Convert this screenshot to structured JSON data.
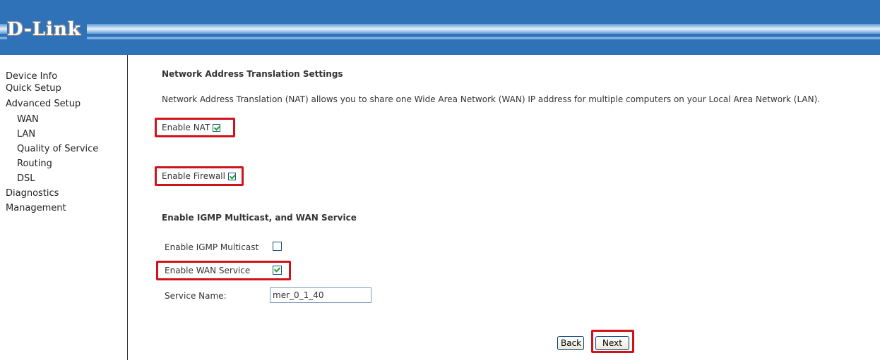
{
  "header": {
    "logo_text": "D-Link"
  },
  "sidebar": {
    "items": [
      {
        "label": "Device Info"
      },
      {
        "label": "Quick Setup"
      },
      {
        "label": "Advanced Setup"
      },
      {
        "label": "WAN"
      },
      {
        "label": "LAN"
      },
      {
        "label": "Quality of Service"
      },
      {
        "label": "Routing"
      },
      {
        "label": "DSL"
      },
      {
        "label": "Diagnostics"
      },
      {
        "label": "Management"
      }
    ]
  },
  "main": {
    "title": "Network Address Translation Settings",
    "description": "Network Address Translation (NAT) allows you to share one Wide Area Network (WAN) IP address for multiple computers on your Local Area Network (LAN).",
    "enable_nat": {
      "label": "Enable NAT",
      "checked": true
    },
    "enable_firewall": {
      "label": "Enable Firewall",
      "checked": true
    },
    "igmp_heading": "Enable IGMP Multicast, and WAN Service",
    "enable_igmp": {
      "label": "Enable IGMP Multicast",
      "checked": false
    },
    "enable_wan": {
      "label": "Enable WAN Service",
      "checked": true
    },
    "service_name": {
      "label": "Service Name:",
      "value": "mer_0_1_40"
    },
    "back_label": "Back",
    "next_label": "Next"
  },
  "colors": {
    "header_blue": "#2f72b8",
    "highlight_red": "#d0121b",
    "check_green": "#21a121"
  }
}
